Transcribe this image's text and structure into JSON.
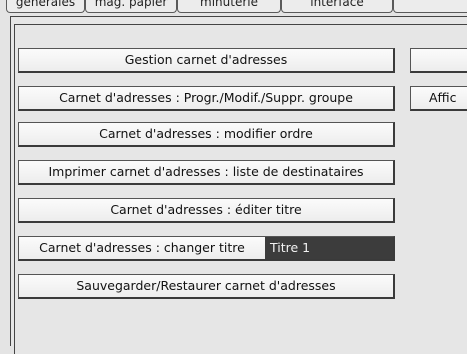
{
  "tabs": [
    {
      "label": "générales"
    },
    {
      "label": "mag. papier"
    },
    {
      "label": "minuterie"
    },
    {
      "label": "interface"
    },
    {
      "label": ""
    }
  ],
  "buttons": {
    "gestion": "Gestion carnet d'adresses",
    "progr": "Carnet d'adresses : Progr./Modif./Suppr. groupe",
    "modifier_ordre": "Carnet d'adresses : modifier ordre",
    "imprimer": "Imprimer carnet d'adresses : liste de destinataires",
    "editer_titre": "Carnet d'adresses : éditer titre",
    "changer_titre": "Carnet d'adresses : changer titre",
    "changer_titre_value": "Titre 1",
    "sauvegarder": "Sauvegarder/Restaurer carnet d'adresses",
    "right_top": "",
    "right_affic": "Affic"
  }
}
